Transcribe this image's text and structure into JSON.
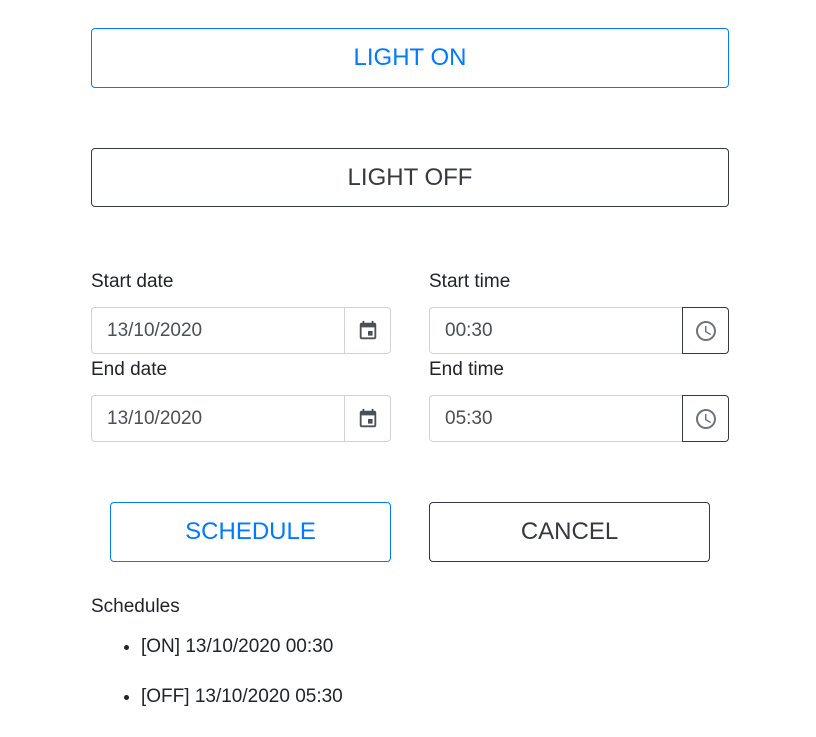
{
  "controls": {
    "light_on_label": "LIGHT ON",
    "light_off_label": "LIGHT OFF"
  },
  "form": {
    "start_date_label": "Start date",
    "start_date_value": "13/10/2020",
    "start_time_label": "Start time",
    "start_time_value": "00:30",
    "end_date_label": "End date",
    "end_date_value": "13/10/2020",
    "end_time_label": "End time",
    "end_time_value": "05:30",
    "date_icon": "calendar-icon",
    "time_icon": "clock-icon"
  },
  "actions": {
    "schedule_label": "SCHEDULE",
    "cancel_label": "CANCEL"
  },
  "schedules": {
    "heading": "Schedules",
    "items": [
      "[ON] 13/10/2020 00:30",
      "[OFF] 13/10/2020 05:30"
    ]
  },
  "colors": {
    "primary": "#007bff",
    "dark": "#343a40",
    "border": "#ced4da",
    "text": "#212529",
    "input_text": "#495057"
  }
}
